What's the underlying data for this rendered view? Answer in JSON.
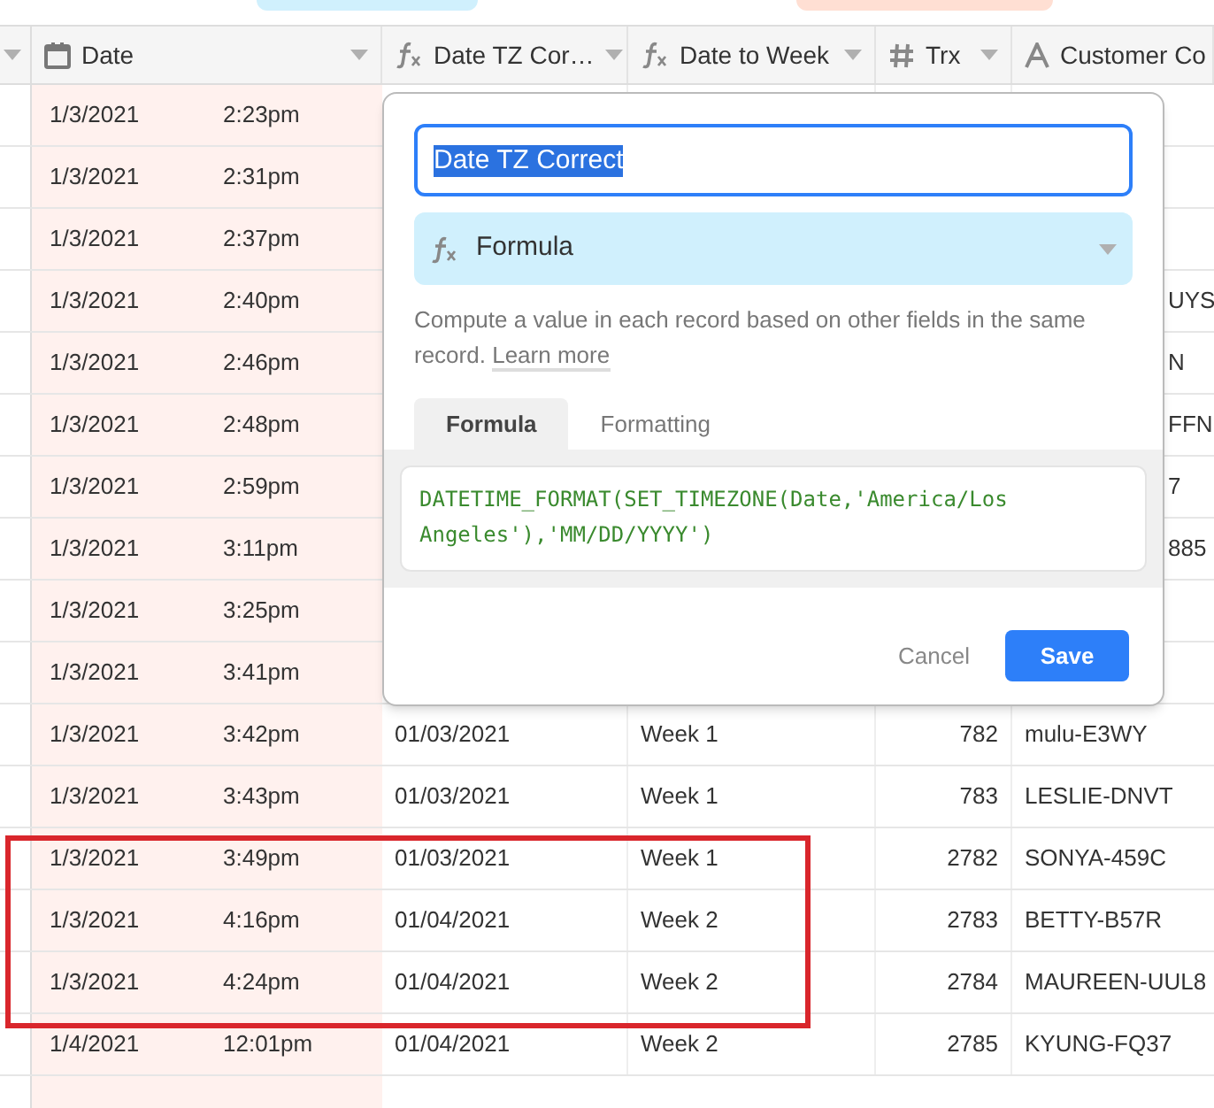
{
  "top_tabs": [
    {
      "color": "#d0f0fd"
    },
    {
      "color": "#ffdfd3"
    }
  ],
  "columns": [
    {
      "label": "Date",
      "kind": "date"
    },
    {
      "label": "Date TZ Cor…",
      "kind": "formula"
    },
    {
      "label": "Date to Week",
      "kind": "formula"
    },
    {
      "label": "Trx",
      "kind": "number"
    },
    {
      "label": "Customer Co",
      "kind": "text"
    }
  ],
  "rows": [
    {
      "date": "1/3/2021",
      "time": "2:23pm"
    },
    {
      "date": "1/3/2021",
      "time": "2:31pm"
    },
    {
      "date": "1/3/2021",
      "time": "2:37pm"
    },
    {
      "date": "1/3/2021",
      "time": "2:40pm",
      "customer": "UYS"
    },
    {
      "date": "1/3/2021",
      "time": "2:46pm",
      "customer": "N"
    },
    {
      "date": "1/3/2021",
      "time": "2:48pm",
      "customer": "FFN"
    },
    {
      "date": "1/3/2021",
      "time": "2:59pm",
      "customer": "7"
    },
    {
      "date": "1/3/2021",
      "time": "3:11pm",
      "customer": "885"
    },
    {
      "date": "1/3/2021",
      "time": "3:25pm"
    },
    {
      "date": "1/3/2021",
      "time": "3:41pm"
    },
    {
      "date": "1/3/2021",
      "time": "3:42pm",
      "tz": "01/03/2021",
      "week": "Week 1",
      "trx": "782",
      "customer": "mulu-E3WY"
    },
    {
      "date": "1/3/2021",
      "time": "3:43pm",
      "tz": "01/03/2021",
      "week": "Week 1",
      "trx": "783",
      "customer": "LESLIE-DNVT"
    },
    {
      "date": "1/3/2021",
      "time": "3:49pm",
      "tz": "01/03/2021",
      "week": "Week 1",
      "trx": "2782",
      "customer": "SONYA-459C"
    },
    {
      "date": "1/3/2021",
      "time": "4:16pm",
      "tz": "01/04/2021",
      "week": "Week 2",
      "trx": "2783",
      "customer": "BETTY-B57R"
    },
    {
      "date": "1/3/2021",
      "time": "4:24pm",
      "tz": "01/04/2021",
      "week": "Week 2",
      "trx": "2784",
      "customer": "MAUREEN-UUL8"
    },
    {
      "date": "1/4/2021",
      "time": "12:01pm",
      "tz": "01/04/2021",
      "week": "Week 2",
      "trx": "2785",
      "customer": "KYUNG-FQ37"
    }
  ],
  "dialog": {
    "name_value": "Date TZ Correct",
    "field_type": "Formula",
    "description": "Compute a value in each record based on other fields in the same record.",
    "learn_more": "Learn more",
    "tabs": [
      {
        "label": "Formula",
        "selected": true
      },
      {
        "label": "Formatting",
        "selected": false
      }
    ],
    "formula": "DATETIME_FORMAT(SET_TIMEZONE(Date,'America/Los Angeles'),'MM/DD/YYYY')",
    "cancel": "Cancel",
    "save": "Save"
  }
}
